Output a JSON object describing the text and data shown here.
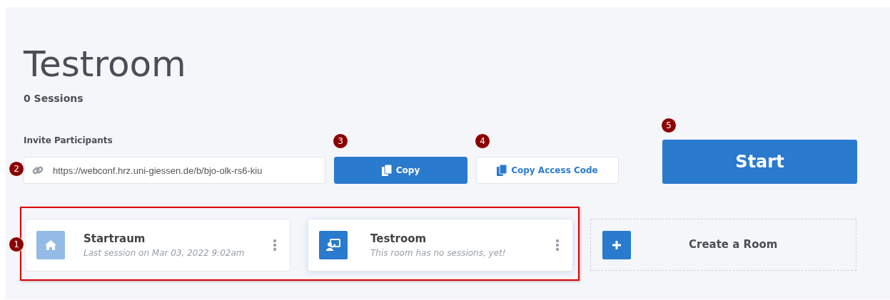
{
  "room_title": "Testroom",
  "sessions": "0 Sessions",
  "invite": {
    "label": "Invite Participants",
    "url": "https://webconf.hrz.uni-giessen.de/b/bjo-olk-rs6-kiu"
  },
  "buttons": [
    {
      "label": "Copy",
      "kind": "primary"
    },
    {
      "label": "Copy Access Code",
      "kind": "outline"
    }
  ],
  "start_button": "Start",
  "rooms": [
    {
      "name": "Startraum",
      "subtitle": "Last session on Mar 03, 2022 9:02am",
      "selected": false
    },
    {
      "name": "Testroom",
      "subtitle": "This room has no sessions, yet!",
      "selected": true
    }
  ],
  "create_room": "Create a Room",
  "callouts": [
    "1",
    "2",
    "3",
    "4",
    "5"
  ]
}
